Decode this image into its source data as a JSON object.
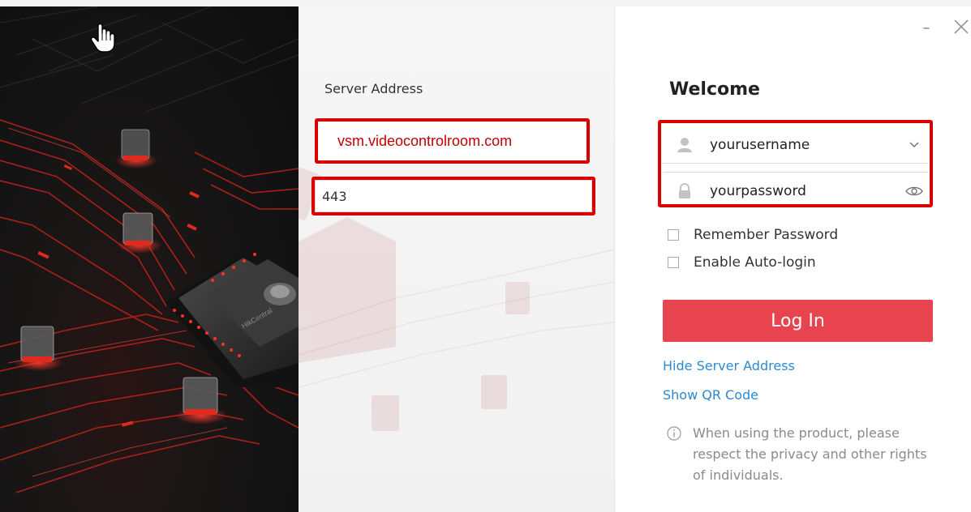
{
  "server": {
    "label": "Server Address",
    "address_value": "vsm.videocontrolroom.com",
    "port_value": "443"
  },
  "login": {
    "title": "Welcome",
    "username_value": "yourusername",
    "password_value": "yourpassword",
    "remember_label": "Remember Password",
    "remember_checked": false,
    "autologin_label": "Enable Auto-login",
    "autologin_checked": false,
    "button_label": "Log In",
    "hide_server_link": "Hide Server Address",
    "qr_link": "Show QR Code",
    "notice": "When using the product, please respect the privacy and other rights of individuals.",
    "chip_brand": "HikCentral"
  },
  "window": {
    "minimize_symbol": "–",
    "close_icon": "close-icon"
  },
  "colors": {
    "accent": "#e8444f",
    "highlight": "#d90000",
    "link": "#2d8ad0"
  }
}
